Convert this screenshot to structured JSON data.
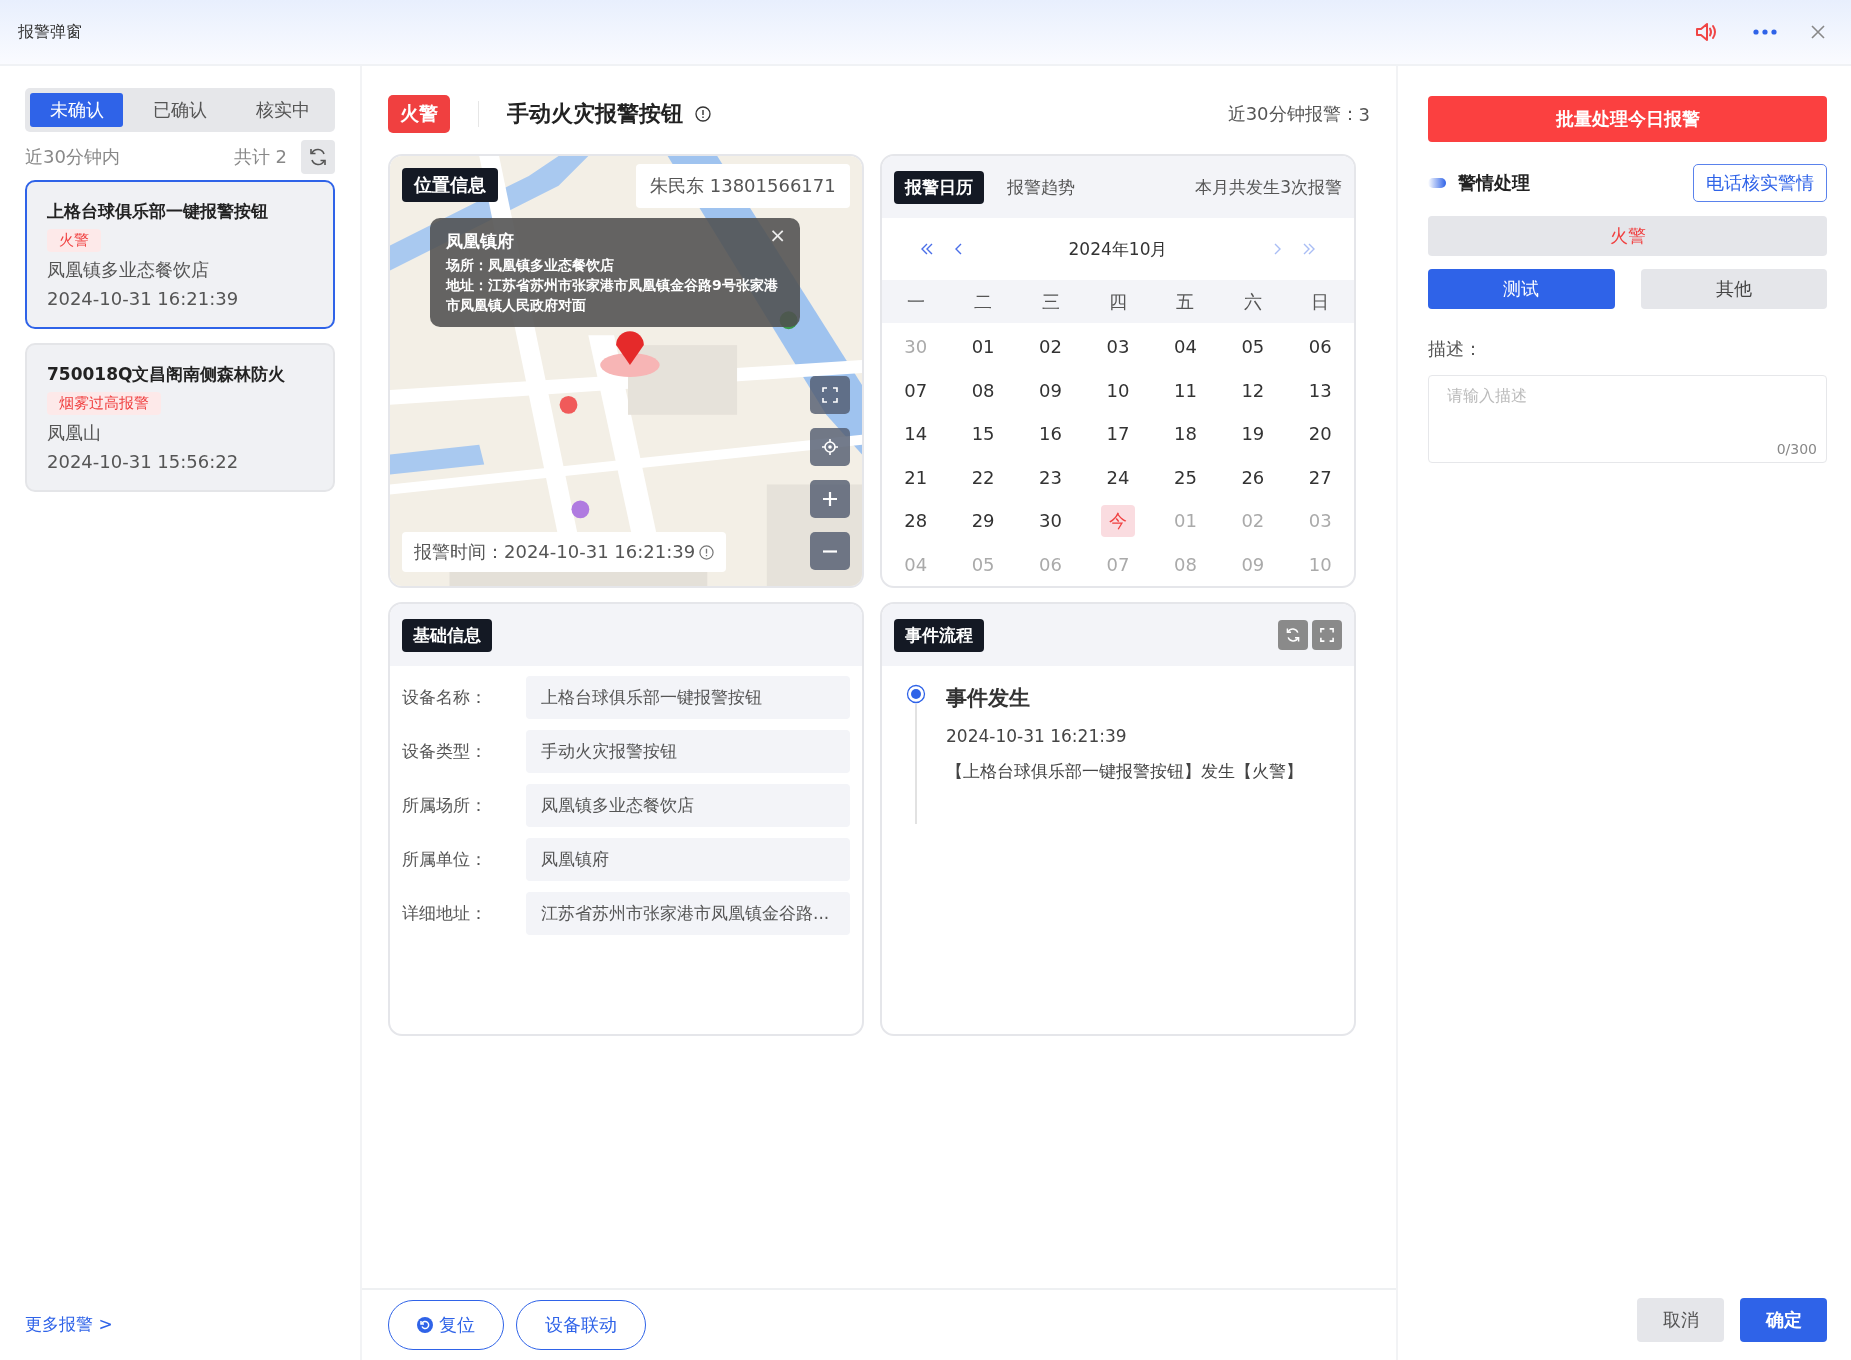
{
  "window": {
    "title": "报警弹窗"
  },
  "left": {
    "tabs": [
      {
        "label": "未确认",
        "selected": true
      },
      {
        "label": "已确认",
        "selected": false
      },
      {
        "label": "核实中",
        "selected": false
      }
    ],
    "range": "近30分钟内",
    "total": "共计 2",
    "alarms": [
      {
        "name": "上格台球俱乐部一键报警按钮",
        "tag": "火警",
        "place": "凤凰镇多业态餐饮店",
        "time": "2024-10-31 16:21:39",
        "selected": true
      },
      {
        "name": "750018Q文昌阁南侧森林防火",
        "tag": "烟雾过高报警",
        "place": "凤凰山",
        "time": "2024-10-31 15:56:22",
        "selected": false
      }
    ],
    "more": "更多报警 >"
  },
  "detail": {
    "badge": "火警",
    "title": "手动火灾报警按钮",
    "recent_label": "近30分钟报警：",
    "recent_count": "3"
  },
  "map": {
    "label": "位置信息",
    "contact": "朱民东 13801566171",
    "popup": {
      "title": "凤凰镇府",
      "lines": [
        "场所：凤凰镇多业态餐饮店",
        "地址：江苏省苏州市张家港市凤凰镇金谷路9号张家港市凤凰镇人民政府对面"
      ],
      "close": "×"
    },
    "alarm_time": "报警时间：2024-10-31 16:21:39"
  },
  "calendar": {
    "tabs": [
      {
        "label": "报警日历",
        "selected": true
      },
      {
        "label": "报警趋势",
        "selected": false
      }
    ],
    "summary_prefix": "本月共发生",
    "summary_count": "3",
    "summary_suffix": "次报警",
    "month": "2024年10月",
    "weekdays": [
      "一",
      "二",
      "三",
      "四",
      "五",
      "六",
      "日"
    ],
    "days": [
      {
        "label": "30",
        "kind": "other"
      },
      {
        "label": "01",
        "kind": "current"
      },
      {
        "label": "02",
        "kind": "current"
      },
      {
        "label": "03",
        "kind": "current"
      },
      {
        "label": "04",
        "kind": "current"
      },
      {
        "label": "05",
        "kind": "current"
      },
      {
        "label": "06",
        "kind": "current"
      },
      {
        "label": "07",
        "kind": "current"
      },
      {
        "label": "08",
        "kind": "current"
      },
      {
        "label": "09",
        "kind": "current"
      },
      {
        "label": "10",
        "kind": "current"
      },
      {
        "label": "11",
        "kind": "current"
      },
      {
        "label": "12",
        "kind": "current"
      },
      {
        "label": "13",
        "kind": "current"
      },
      {
        "label": "14",
        "kind": "current"
      },
      {
        "label": "15",
        "kind": "current"
      },
      {
        "label": "16",
        "kind": "current"
      },
      {
        "label": "17",
        "kind": "current"
      },
      {
        "label": "18",
        "kind": "current"
      },
      {
        "label": "19",
        "kind": "current"
      },
      {
        "label": "20",
        "kind": "current"
      },
      {
        "label": "21",
        "kind": "current"
      },
      {
        "label": "22",
        "kind": "current"
      },
      {
        "label": "23",
        "kind": "current"
      },
      {
        "label": "24",
        "kind": "current"
      },
      {
        "label": "25",
        "kind": "current"
      },
      {
        "label": "26",
        "kind": "current"
      },
      {
        "label": "27",
        "kind": "current"
      },
      {
        "label": "28",
        "kind": "current"
      },
      {
        "label": "29",
        "kind": "current"
      },
      {
        "label": "30",
        "kind": "current"
      },
      {
        "label": "今",
        "kind": "today"
      },
      {
        "label": "01",
        "kind": "other"
      },
      {
        "label": "02",
        "kind": "other"
      },
      {
        "label": "03",
        "kind": "other"
      },
      {
        "label": "04",
        "kind": "other"
      },
      {
        "label": "05",
        "kind": "other"
      },
      {
        "label": "06",
        "kind": "other"
      },
      {
        "label": "07",
        "kind": "other"
      },
      {
        "label": "08",
        "kind": "other"
      },
      {
        "label": "09",
        "kind": "other"
      },
      {
        "label": "10",
        "kind": "other"
      }
    ]
  },
  "basic_info": {
    "label": "基础信息",
    "fields": [
      {
        "label": "设备名称：",
        "value": "上格台球俱乐部一键报警按钮"
      },
      {
        "label": "设备类型：",
        "value": "手动火灾报警按钮"
      },
      {
        "label": "所属场所：",
        "value": "凤凰镇多业态餐饮店"
      },
      {
        "label": "所属单位：",
        "value": "凤凰镇府"
      },
      {
        "label": "详细地址：",
        "value": "江苏省苏州市张家港市凤凰镇金谷路..."
      }
    ]
  },
  "event_flow": {
    "label": "事件流程",
    "events": [
      {
        "title": "事件发生",
        "time": "2024-10-31 16:21:39",
        "text": "【上格台球俱乐部一键报警按钮】发生【火警】"
      }
    ]
  },
  "footer_buttons": [
    "复位",
    "设备联动"
  ],
  "handling": {
    "batch_button": "批量处理今日报警",
    "title": "警情处理",
    "phone_button": "电话核实警情",
    "types": [
      {
        "label": "火警",
        "selected": false,
        "kind": "alarm"
      },
      {
        "label": "测试",
        "selected": true,
        "kind": "option"
      },
      {
        "label": "其他",
        "selected": false,
        "kind": "option"
      }
    ],
    "desc_label": "描述：",
    "desc_placeholder": "请输入描述",
    "desc_count": "0/300",
    "cancel": "取消",
    "confirm": "确定"
  }
}
